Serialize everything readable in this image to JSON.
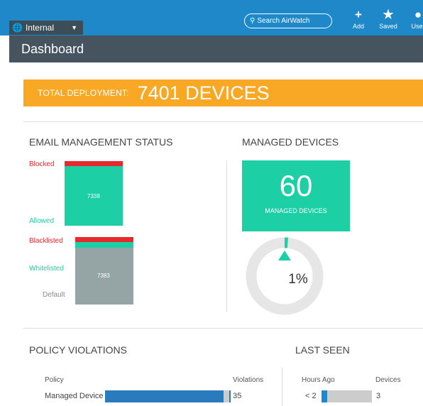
{
  "topbar": {
    "org_label": "Internal",
    "search_placeholder": "Search AirWatch",
    "buttons": [
      {
        "label": "Add",
        "icon": "plus-icon"
      },
      {
        "label": "Saved",
        "icon": "star-icon"
      },
      {
        "label": "User",
        "icon": "user-icon"
      }
    ]
  },
  "page": {
    "title": "Dashboard"
  },
  "deployment": {
    "label": "TOTAL DEPLOYMENT:",
    "value": "7401 DEVICES"
  },
  "email_status": {
    "title": "EMAIL MANAGEMENT STATUS",
    "chart1": {
      "blocked_label": "Blocked",
      "allowed_label": "Allowed",
      "allowed_value": "7338"
    },
    "chart2": {
      "blacklisted_label": "Blacklisted",
      "whitelisted_label": "Whitelisted",
      "default_label": "Default",
      "default_value": "7383"
    }
  },
  "managed_devices": {
    "title": "MANAGED DEVICES",
    "count": "60",
    "count_label": "MANAGED DEVICES",
    "percent_label": "1%",
    "percent_value": 1
  },
  "policy_violations": {
    "title": "POLICY VIOLATIONS",
    "col_policy": "Policy",
    "col_violations": "Violations",
    "rows": [
      {
        "policy": "Managed Device",
        "violations": "35"
      }
    ]
  },
  "last_seen": {
    "title": "LAST SEEN",
    "col_hours": "Hours Ago",
    "col_devices": "Devices",
    "rows": [
      {
        "hours": "< 2",
        "devices": "3"
      }
    ]
  },
  "colors": {
    "topbar": "#1e88c8",
    "titlebar": "#45545f",
    "banner": "#f9a825",
    "teal": "#1ccfa5",
    "red": "#e8282f",
    "gray": "#95a5a6",
    "blue_bar": "#2a7bbd"
  }
}
